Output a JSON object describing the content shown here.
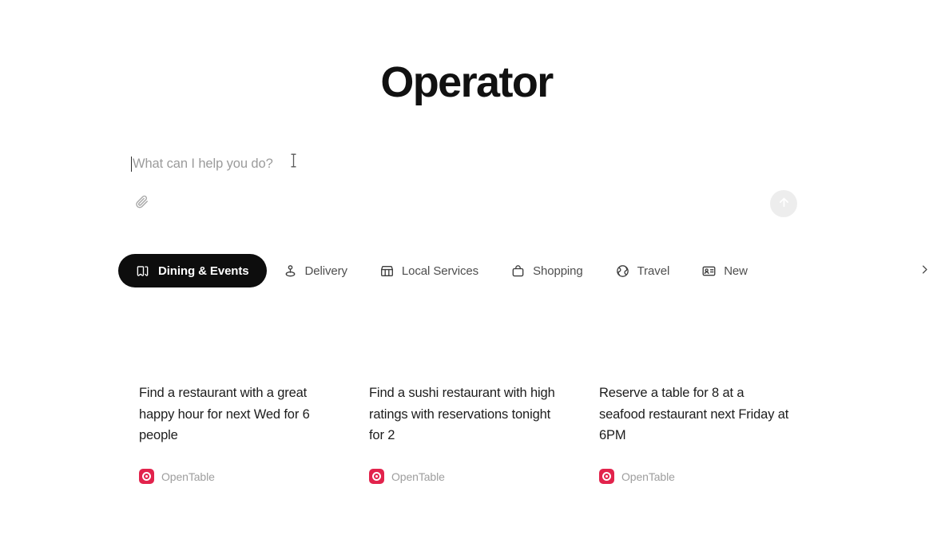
{
  "app": {
    "title": "Operator",
    "accent_black": "#0d0d0d",
    "muted_text": "#9b9b9b"
  },
  "composer": {
    "placeholder": "What can I help you do?",
    "value": "",
    "attach_icon": "paperclip-icon",
    "submit_icon": "arrow-up-icon",
    "cursor_icon": "i-beam-cursor"
  },
  "tabs": {
    "next_icon": "chevron-right-icon",
    "items": [
      {
        "label": "Dining & Events",
        "icon": "tickets-icon",
        "active": true
      },
      {
        "label": "Delivery",
        "icon": "map-pin-icon",
        "active": false
      },
      {
        "label": "Local Services",
        "icon": "storefront-icon",
        "active": false
      },
      {
        "label": "Shopping",
        "icon": "shopping-bag-icon",
        "active": false
      },
      {
        "label": "Travel",
        "icon": "globe-icon",
        "active": false
      },
      {
        "label": "New",
        "icon": "id-card-icon",
        "active": false
      }
    ]
  },
  "suggestions": {
    "cards": [
      {
        "text": "Find a restaurant with a great happy hour for next Wed for 6 people",
        "source": "OpenTable",
        "source_color": "#E2234C"
      },
      {
        "text": "Find a sushi restaurant with high ratings with reservations tonight for 2",
        "source": "OpenTable",
        "source_color": "#E2234C"
      },
      {
        "text": "Reserve a table for 8 at a seafood restaurant next Friday at 6PM",
        "source": "OpenTable",
        "source_color": "#E2234C"
      }
    ]
  }
}
